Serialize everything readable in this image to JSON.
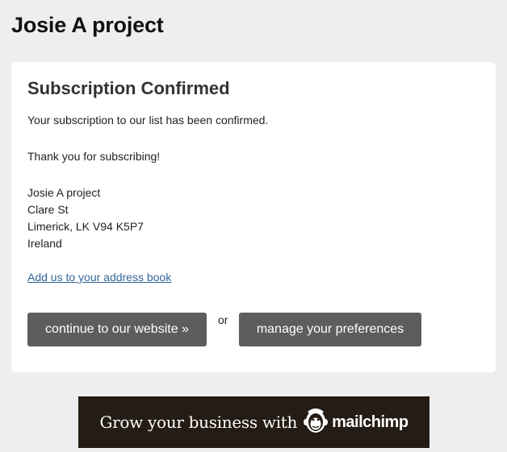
{
  "header": {
    "org_name": "Josie A project"
  },
  "card": {
    "heading": "Subscription Confirmed",
    "confirmed_text": "Your subscription to our list has been confirmed.",
    "thanks_text": "Thank you for subscribing!",
    "address": {
      "name": "Josie A project",
      "street": "Clare St",
      "city_line": "Limerick, LK V94 K5P7",
      "country": "Ireland"
    },
    "address_book_link": "Add us to your address book",
    "continue_button": "continue to our website »",
    "or_text": "or",
    "preferences_button": "manage your preferences"
  },
  "banner": {
    "tagline": "Grow your business with",
    "brand": "mailchimp",
    "logo_icon": "mailchimp-freddie-icon",
    "background_color": "#241c15"
  },
  "colors": {
    "page_background": "#eeeeee",
    "button_background": "#5d5d5d",
    "link_color": "#336699"
  }
}
